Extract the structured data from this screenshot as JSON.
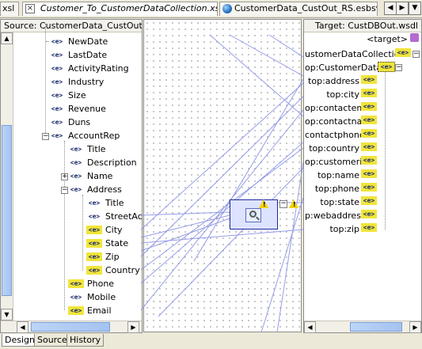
{
  "tabs": {
    "left_partial": "xsl",
    "active_tab": "Customer_To_CustomerDataCollection.xsl",
    "second_tab": "CustomerData_CustOut_RS.esbsvc"
  },
  "source": {
    "header": "Source: CustomerData_CustOut_R",
    "nodes": [
      {
        "label": "NewDate"
      },
      {
        "label": "LastDate"
      },
      {
        "label": "ActivityRating"
      },
      {
        "label": "Industry"
      },
      {
        "label": "Size"
      },
      {
        "label": "Revenue"
      },
      {
        "label": "Duns"
      },
      {
        "label": "AccountRep"
      },
      {
        "label": "Title"
      },
      {
        "label": "Description"
      },
      {
        "label": "Name"
      },
      {
        "label": "Address"
      },
      {
        "label": "Title"
      },
      {
        "label": "StreetAc"
      },
      {
        "label": "City"
      },
      {
        "label": "State"
      },
      {
        "label": "Zip"
      },
      {
        "label": "Country"
      },
      {
        "label": "Phone"
      },
      {
        "label": "Mobile"
      },
      {
        "label": "Email"
      }
    ]
  },
  "target": {
    "header": "Target: CustDBOut.wsdl",
    "nodes": [
      {
        "label": "<target>"
      },
      {
        "label": "ustomerDataCollection"
      },
      {
        "label": "op:CustomerData"
      },
      {
        "label": "top:address"
      },
      {
        "label": "top:city"
      },
      {
        "label": "op:contactemail"
      },
      {
        "label": "op:contactname"
      },
      {
        "label": "contactphone"
      },
      {
        "label": "top:country"
      },
      {
        "label": "op:customerid"
      },
      {
        "label": "top:name"
      },
      {
        "label": "top:phone"
      },
      {
        "label": "top:state"
      },
      {
        "label": "p:webaddress"
      },
      {
        "label": "top:zip"
      }
    ]
  },
  "bottom_tabs": {
    "design": "Design",
    "source": "Source",
    "history": "History"
  },
  "icons": {
    "element": "element-icon",
    "warning": "warning-icon",
    "function": "lookup-function-icon"
  },
  "colors": {
    "link_line": "#8a93e6",
    "function_border": "#1e2a9e",
    "function_fill": "#dde3ff",
    "warning": "#f2d300"
  }
}
